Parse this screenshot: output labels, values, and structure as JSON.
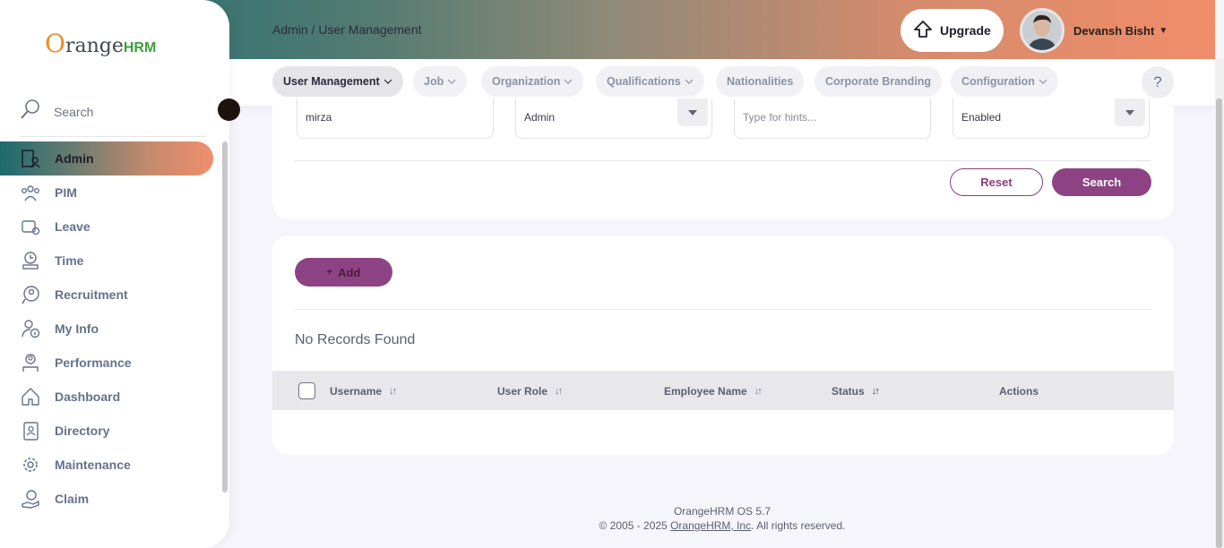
{
  "header": {
    "breadcrumb": "Admin / User Management",
    "upgrade_label": "Upgrade",
    "user_name": "Devansh Bisht"
  },
  "subnav": {
    "items": [
      {
        "label": "User Management",
        "dropdown": true,
        "active": true
      },
      {
        "label": "Job",
        "dropdown": true
      },
      {
        "label": "Organization",
        "dropdown": true
      },
      {
        "label": "Qualifications",
        "dropdown": true
      },
      {
        "label": "Nationalities",
        "dropdown": false
      },
      {
        "label": "Corporate Branding",
        "dropdown": false
      },
      {
        "label": "Configuration",
        "dropdown": true
      }
    ],
    "help_label": "?"
  },
  "filters": {
    "username_value": "mirza",
    "user_role_value": "Admin",
    "employee_name_placeholder": "Type for hints...",
    "status_value": "Enabled",
    "reset_label": "Reset",
    "search_label": "Search"
  },
  "results": {
    "add_label": "Add",
    "no_records": "No Records Found",
    "columns": [
      "Username",
      "User Role",
      "Employee Name",
      "Status",
      "Actions"
    ]
  },
  "footer": {
    "version": "OrangeHRM OS 5.7",
    "copyright_prefix": "© 2005 - 2025 ",
    "link_text": "OrangeHRM, Inc",
    "copyright_suffix": ". All rights reserved."
  },
  "sidebar": {
    "logo_o": "O",
    "logo_range": "range",
    "logo_hrm": "HRM",
    "search_label": "Search",
    "items": [
      {
        "label": "Admin",
        "icon": "admin-icon",
        "active": true
      },
      {
        "label": "PIM",
        "icon": "pim-icon"
      },
      {
        "label": "Leave",
        "icon": "leave-icon"
      },
      {
        "label": "Time",
        "icon": "time-icon"
      },
      {
        "label": "Recruitment",
        "icon": "recruitment-icon"
      },
      {
        "label": "My Info",
        "icon": "my-info-icon"
      },
      {
        "label": "Performance",
        "icon": "performance-icon"
      },
      {
        "label": "Dashboard",
        "icon": "dashboard-icon"
      },
      {
        "label": "Directory",
        "icon": "directory-icon"
      },
      {
        "label": "Maintenance",
        "icon": "maintenance-icon"
      },
      {
        "label": "Claim",
        "icon": "claim-icon"
      }
    ]
  },
  "colors": {
    "accent": "#8d4383",
    "brand_orange": "#f28b21",
    "brand_green": "#3c9e3c"
  }
}
